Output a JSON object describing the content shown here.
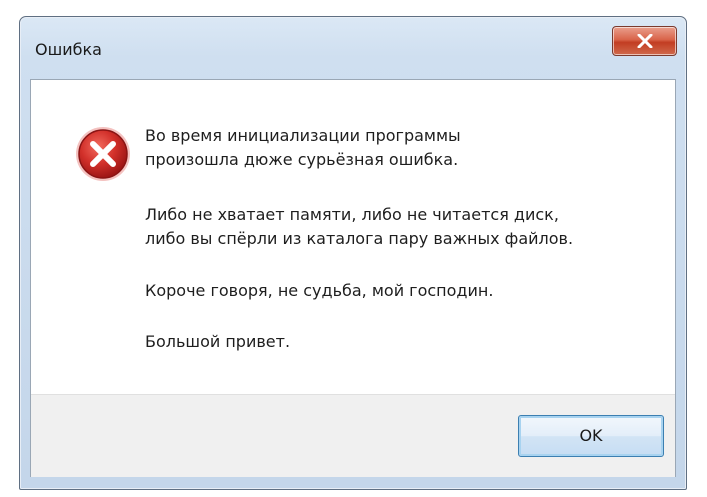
{
  "window": {
    "title": "Ошибка"
  },
  "message": {
    "line1": "Во время инициализации программы",
    "line2": "произошла дюже сурьёзная ошибка.",
    "line3": "Либо не хватает памяти, либо не читается диск,",
    "line4": "либо вы спёрли из каталога пару важных файлов.",
    "line5": "Короче говоря, не судьба, мой господин.",
    "line6": "Большой привет."
  },
  "buttons": {
    "ok_label": "OK"
  },
  "icons": {
    "close": "close-icon",
    "error": "error-icon"
  },
  "colors": {
    "error_red": "#c0282a",
    "close_button": "#c94a30",
    "ok_border": "#3c7fb1"
  }
}
